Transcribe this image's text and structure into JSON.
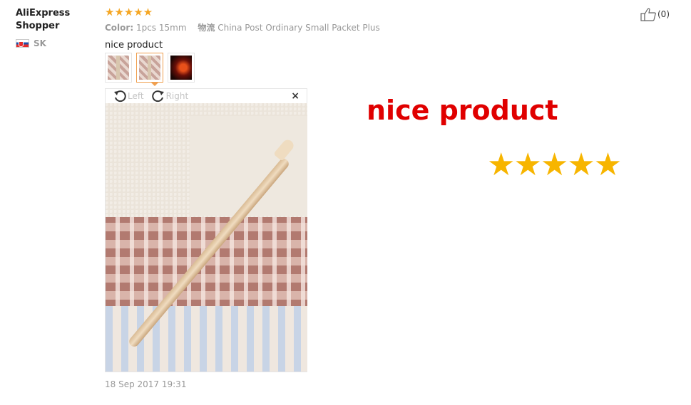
{
  "reviewer": {
    "name": "AliExpress Shopper",
    "country_code": "SK"
  },
  "review": {
    "stars": "★★★★★",
    "color_label": "Color:",
    "color_value": "1pcs 15mm",
    "logistics_label": "物流",
    "logistics_value": "China Post Ordinary Small Packet Plus",
    "text": "nice product",
    "date": "18 Sep 2017 19:31"
  },
  "viewer": {
    "rotate_left_label": "Left",
    "rotate_right_label": "Right",
    "close_symbol": "×"
  },
  "like": {
    "count_text": "(0)"
  },
  "overlay": {
    "big_text": "nice product",
    "big_stars": "★★★★★"
  },
  "colors": {
    "star": "#f5a623",
    "overlay_text": "#e00000",
    "overlay_stars": "#f7b500",
    "active_thumb": "#f0a050"
  },
  "icons": [
    "thumbs-up-icon",
    "rotate-left-icon",
    "rotate-right-icon",
    "close-icon",
    "flag-icon"
  ]
}
